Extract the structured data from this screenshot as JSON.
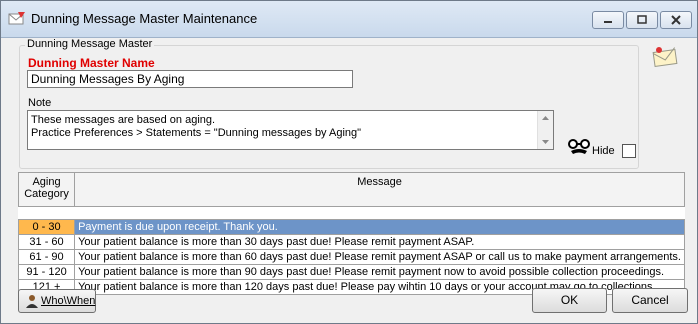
{
  "window": {
    "title": "Dunning Message Master Maintenance",
    "controls": [
      "minimize",
      "restore",
      "close"
    ]
  },
  "form": {
    "group_title": "Dunning Message Master",
    "name_label": "Dunning Master Name",
    "name_value": "Dunning Messages By Aging",
    "note_label": "Note",
    "note_value": "These messages are based on aging.\nPractice Preferences > Statements = \"Dunning messages by Aging\"",
    "hide_label": "Hide",
    "hide_checked": false
  },
  "grid": {
    "columns": [
      "Aging Category",
      "Message"
    ],
    "rows": [
      {
        "category": "0 - 30",
        "message": "Payment is due upon receipt.  Thank you.",
        "selected": true
      },
      {
        "category": "31 - 60",
        "message": "Your patient balance is more than 30 days past due!  Please remit payment ASAP.",
        "selected": false
      },
      {
        "category": "61 - 90",
        "message": "Your patient balance is more than 60 days past due!  Please remit payment ASAP or call us to make payment arrangements.",
        "selected": false
      },
      {
        "category": "91 - 120",
        "message": "Your patient balance is more than 90 days past due!  Please remit payment now to avoid possible collection proceedings.",
        "selected": false
      },
      {
        "category": "121 +",
        "message": "Your patient balance is more than 120 days past due!  Please pay wihtin 10 days or your account may go to collections.",
        "selected": false
      }
    ]
  },
  "buttons": {
    "who_when": "Who\\When",
    "ok": "OK",
    "cancel": "Cancel"
  },
  "colors": {
    "selected_category_bg": "#ffb84d",
    "selected_message_bg": "#6d94c8",
    "required_label": "#e00000"
  }
}
